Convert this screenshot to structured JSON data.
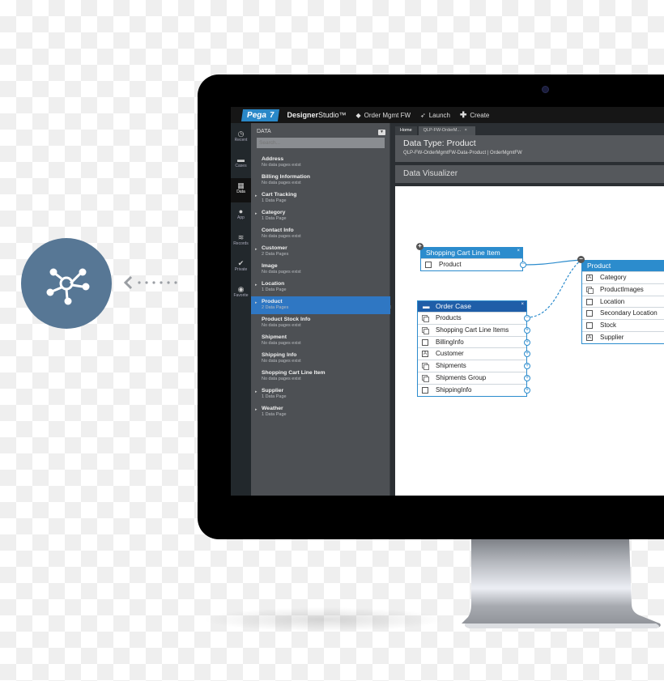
{
  "promo": {
    "hub_icon": "network-hub-icon",
    "arrow_icon": "chevron-left-icon"
  },
  "app": {
    "logo_brand": "Pega",
    "logo_version": "7",
    "studio_bold": "Designer",
    "studio_light": "Studio™",
    "toolbar": [
      {
        "icon": "cube-icon",
        "label": "Order Mgmt FW"
      },
      {
        "icon": "rocket-icon",
        "label": "Launch"
      },
      {
        "icon": "plus-icon",
        "label": "Create"
      }
    ]
  },
  "left_nav": [
    {
      "icon": "clock-icon",
      "glyph": "◷",
      "label": "Recent",
      "active": false
    },
    {
      "icon": "briefcase-icon",
      "glyph": "▬",
      "label": "Cases",
      "active": false
    },
    {
      "icon": "grid-icon",
      "glyph": "▦",
      "label": "Data",
      "active": true
    },
    {
      "icon": "app-icon",
      "glyph": "●",
      "label": "App",
      "active": false
    },
    {
      "icon": "records-icon",
      "glyph": "≋",
      "label": "Records",
      "active": false
    },
    {
      "icon": "check-icon",
      "glyph": "✔",
      "label": "Private",
      "active": false
    },
    {
      "icon": "favorite-icon",
      "glyph": "◉",
      "label": "Favorite",
      "active": false
    }
  ],
  "data_panel": {
    "title": "DATA",
    "search_placeholder": "Search...",
    "items": [
      {
        "name": "Address",
        "sub": "No data pages exist",
        "expandable": false
      },
      {
        "name": "Billing Information",
        "sub": "No data pages exist",
        "expandable": false
      },
      {
        "name": "Cart Tracking",
        "sub": "1 Data Page",
        "expandable": true
      },
      {
        "name": "Category",
        "sub": "1 Data Page",
        "expandable": true
      },
      {
        "name": "Contact Info",
        "sub": "No data pages exist",
        "expandable": false
      },
      {
        "name": "Customer",
        "sub": "2 Data Pages",
        "expandable": true
      },
      {
        "name": "Image",
        "sub": "No data pages exist",
        "expandable": false
      },
      {
        "name": "Location",
        "sub": "1 Data Page",
        "expandable": true
      },
      {
        "name": "Product",
        "sub": "2 Data Pages",
        "expandable": true,
        "selected": true
      },
      {
        "name": "Product Stock Info",
        "sub": "No data pages exist",
        "expandable": false
      },
      {
        "name": "Shipment",
        "sub": "No data pages exist",
        "expandable": false
      },
      {
        "name": "Shipping Info",
        "sub": "No data pages exist",
        "expandable": false
      },
      {
        "name": "Shopping Cart Line Item",
        "sub": "No data pages exist",
        "expandable": false
      },
      {
        "name": "Supplier",
        "sub": "1 Data Page",
        "expandable": true
      },
      {
        "name": "Weather",
        "sub": "1 Data Page",
        "expandable": true
      }
    ]
  },
  "tabs": [
    {
      "label": "Home"
    },
    {
      "label": "QLP-FW-OrderM..."
    }
  ],
  "header": {
    "title": "Data Type: Product",
    "class_name": "QLP-FW-OrderMgmtFW-Data-Product",
    "ruleset": "OrderMgmtFW"
  },
  "visualizer": {
    "title": "Data Visualizer",
    "nodes": {
      "shopping_cart": {
        "title": "Shopping Cart Line Item",
        "header_color": "#2c8ccd",
        "fields": [
          {
            "label": "Product",
            "type": "single"
          }
        ]
      },
      "order_case": {
        "title": "Order Case",
        "header_color": "#1f5ea8",
        "fields": [
          {
            "label": "Products",
            "type": "list"
          },
          {
            "label": "Shopping Cart Line Items",
            "type": "list"
          },
          {
            "label": "BillingInfo",
            "type": "single"
          },
          {
            "label": "Customer",
            "type": "text"
          },
          {
            "label": "Shipments",
            "type": "list"
          },
          {
            "label": "Shipments Group",
            "type": "group"
          },
          {
            "label": "ShippingInfo",
            "type": "single"
          }
        ]
      },
      "product": {
        "title": "Product",
        "header_color": "#2c8ccd",
        "fields": [
          {
            "label": "Category",
            "type": "text"
          },
          {
            "label": "ProductImages",
            "type": "list"
          },
          {
            "label": "Location",
            "type": "single"
          },
          {
            "label": "Secondary Location",
            "type": "single"
          },
          {
            "label": "Stock",
            "type": "single"
          },
          {
            "label": "Supplier",
            "type": "text"
          }
        ]
      }
    }
  },
  "colors": {
    "accent": "#2c8ccd",
    "selected": "#2f77c3",
    "hub": "#577795"
  }
}
